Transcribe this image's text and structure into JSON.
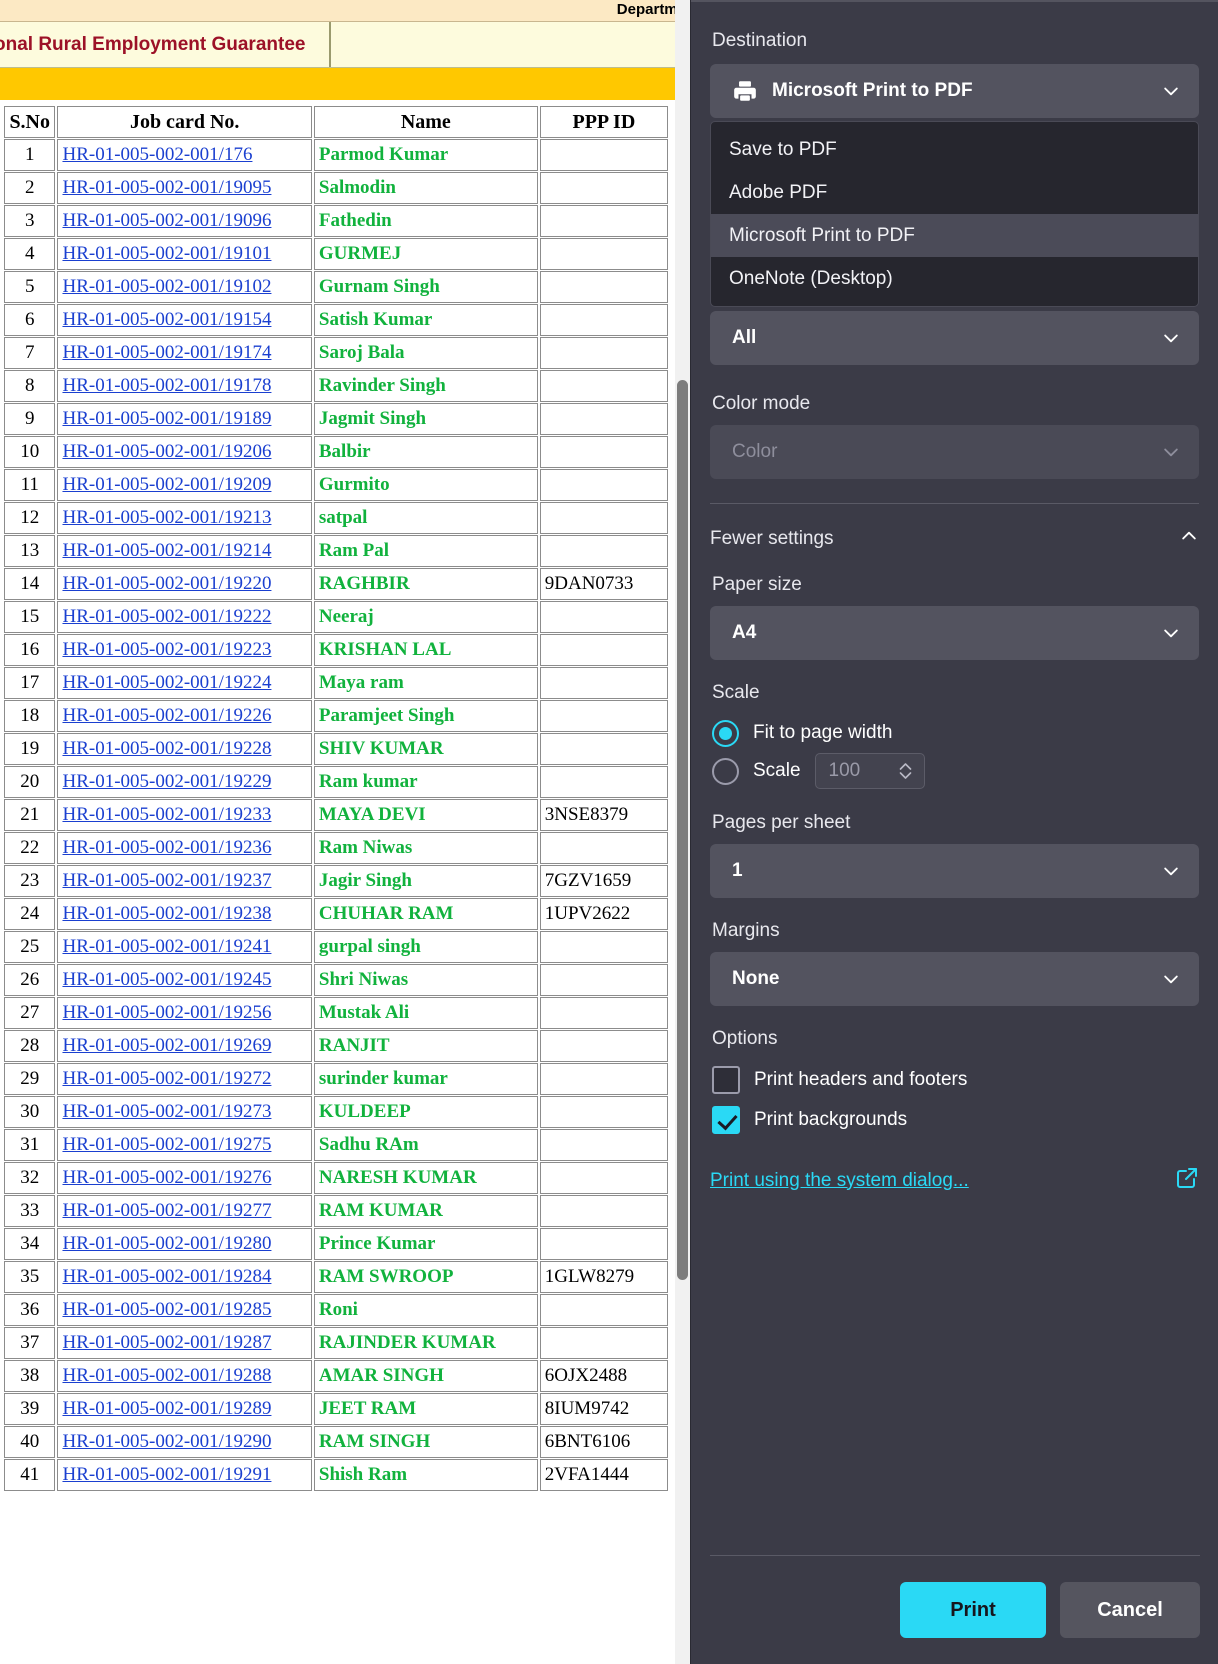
{
  "page": {
    "header_dept_text": "Departme",
    "scheme_title": "onal Rural Employment Guarantee",
    "columns": [
      "S.No",
      "Job card No.",
      "Name",
      "PPP ID"
    ],
    "rows": [
      {
        "sno": "1",
        "job": "HR-01-005-002-001/176",
        "name": "Parmod Kumar",
        "ppp": ""
      },
      {
        "sno": "2",
        "job": "HR-01-005-002-001/19095",
        "name": "Salmodin",
        "ppp": ""
      },
      {
        "sno": "3",
        "job": "HR-01-005-002-001/19096",
        "name": "Fathedin",
        "ppp": ""
      },
      {
        "sno": "4",
        "job": "HR-01-005-002-001/19101",
        "name": "GURMEJ",
        "ppp": ""
      },
      {
        "sno": "5",
        "job": "HR-01-005-002-001/19102",
        "name": "Gurnam Singh",
        "ppp": ""
      },
      {
        "sno": "6",
        "job": "HR-01-005-002-001/19154",
        "name": "Satish Kumar",
        "ppp": ""
      },
      {
        "sno": "7",
        "job": "HR-01-005-002-001/19174",
        "name": "Saroj Bala",
        "ppp": ""
      },
      {
        "sno": "8",
        "job": "HR-01-005-002-001/19178",
        "name": "Ravinder Singh",
        "ppp": ""
      },
      {
        "sno": "9",
        "job": "HR-01-005-002-001/19189",
        "name": "Jagmit Singh",
        "ppp": ""
      },
      {
        "sno": "10",
        "job": "HR-01-005-002-001/19206",
        "name": "Balbir",
        "ppp": ""
      },
      {
        "sno": "11",
        "job": "HR-01-005-002-001/19209",
        "name": "Gurmito",
        "ppp": ""
      },
      {
        "sno": "12",
        "job": "HR-01-005-002-001/19213",
        "name": "satpal",
        "ppp": ""
      },
      {
        "sno": "13",
        "job": "HR-01-005-002-001/19214",
        "name": "Ram Pal",
        "ppp": ""
      },
      {
        "sno": "14",
        "job": "HR-01-005-002-001/19220",
        "name": "RAGHBIR",
        "ppp": "9DAN0733"
      },
      {
        "sno": "15",
        "job": "HR-01-005-002-001/19222",
        "name": "Neeraj",
        "ppp": ""
      },
      {
        "sno": "16",
        "job": "HR-01-005-002-001/19223",
        "name": "KRISHAN LAL",
        "ppp": ""
      },
      {
        "sno": "17",
        "job": "HR-01-005-002-001/19224",
        "name": "Maya ram",
        "ppp": ""
      },
      {
        "sno": "18",
        "job": "HR-01-005-002-001/19226",
        "name": "Paramjeet Singh",
        "ppp": ""
      },
      {
        "sno": "19",
        "job": "HR-01-005-002-001/19228",
        "name": "SHIV KUMAR",
        "ppp": ""
      },
      {
        "sno": "20",
        "job": "HR-01-005-002-001/19229",
        "name": "Ram kumar",
        "ppp": ""
      },
      {
        "sno": "21",
        "job": "HR-01-005-002-001/19233",
        "name": "MAYA DEVI",
        "ppp": "3NSE8379"
      },
      {
        "sno": "22",
        "job": "HR-01-005-002-001/19236",
        "name": "Ram Niwas",
        "ppp": ""
      },
      {
        "sno": "23",
        "job": "HR-01-005-002-001/19237",
        "name": "Jagir Singh",
        "ppp": "7GZV1659"
      },
      {
        "sno": "24",
        "job": "HR-01-005-002-001/19238",
        "name": "CHUHAR RAM",
        "ppp": "1UPV2622"
      },
      {
        "sno": "25",
        "job": "HR-01-005-002-001/19241",
        "name": "gurpal singh",
        "ppp": ""
      },
      {
        "sno": "26",
        "job": "HR-01-005-002-001/19245",
        "name": "Shri Niwas",
        "ppp": ""
      },
      {
        "sno": "27",
        "job": "HR-01-005-002-001/19256",
        "name": "Mustak Ali",
        "ppp": ""
      },
      {
        "sno": "28",
        "job": "HR-01-005-002-001/19269",
        "name": "RANJIT",
        "ppp": ""
      },
      {
        "sno": "29",
        "job": "HR-01-005-002-001/19272",
        "name": "surinder kumar",
        "ppp": ""
      },
      {
        "sno": "30",
        "job": "HR-01-005-002-001/19273",
        "name": "KULDEEP",
        "ppp": ""
      },
      {
        "sno": "31",
        "job": "HR-01-005-002-001/19275",
        "name": "Sadhu RAm",
        "ppp": ""
      },
      {
        "sno": "32",
        "job": "HR-01-005-002-001/19276",
        "name": "NARESH KUMAR",
        "ppp": ""
      },
      {
        "sno": "33",
        "job": "HR-01-005-002-001/19277",
        "name": "RAM KUMAR",
        "ppp": ""
      },
      {
        "sno": "34",
        "job": "HR-01-005-002-001/19280",
        "name": "Prince Kumar",
        "ppp": ""
      },
      {
        "sno": "35",
        "job": "HR-01-005-002-001/19284",
        "name": "RAM SWROOP",
        "ppp": "1GLW8279"
      },
      {
        "sno": "36",
        "job": "HR-01-005-002-001/19285",
        "name": "Roni",
        "ppp": ""
      },
      {
        "sno": "37",
        "job": "HR-01-005-002-001/19287",
        "name": "RAJINDER KUMAR",
        "ppp": ""
      },
      {
        "sno": "38",
        "job": "HR-01-005-002-001/19288",
        "name": "AMAR SINGH",
        "ppp": "6OJX2488"
      },
      {
        "sno": "39",
        "job": "HR-01-005-002-001/19289",
        "name": "JEET RAM",
        "ppp": "8IUM9742"
      },
      {
        "sno": "40",
        "job": "HR-01-005-002-001/19290",
        "name": "RAM SINGH",
        "ppp": "6BNT6106"
      },
      {
        "sno": "41",
        "job": "HR-01-005-002-001/19291",
        "name": "Shish Ram",
        "ppp": "2VFA1444"
      }
    ]
  },
  "print_dialog": {
    "destination": {
      "label": "Destination",
      "selected": "Microsoft Print to PDF",
      "icon": "printer-icon",
      "options": [
        "Save to PDF",
        "Adobe PDF",
        "Microsoft Print to PDF",
        "OneNote (Desktop)"
      ],
      "highlighted_option": "Microsoft Print to PDF"
    },
    "pages": {
      "selected": "All"
    },
    "color_mode": {
      "label": "Color mode",
      "selected": "Color",
      "disabled": true
    },
    "settings_toggle": {
      "label": "Fewer settings",
      "expanded": true
    },
    "paper_size": {
      "label": "Paper size",
      "selected": "A4"
    },
    "scale": {
      "label": "Scale",
      "fit_label": "Fit to page width",
      "scale_label": "Scale",
      "scale_value": "100",
      "selected": "fit"
    },
    "pages_per_sheet": {
      "label": "Pages per sheet",
      "selected": "1"
    },
    "margins": {
      "label": "Margins",
      "selected": "None"
    },
    "options": {
      "label": "Options",
      "headers_footers": {
        "label": "Print headers and footers",
        "checked": false
      },
      "backgrounds": {
        "label": "Print backgrounds",
        "checked": true
      }
    },
    "system_dialog_link": "Print using the system dialog...",
    "buttons": {
      "print": "Print",
      "cancel": "Cancel"
    },
    "colors": {
      "accent": "#2ad9f5",
      "panel": "#3b3b47",
      "control": "#53535f"
    }
  }
}
